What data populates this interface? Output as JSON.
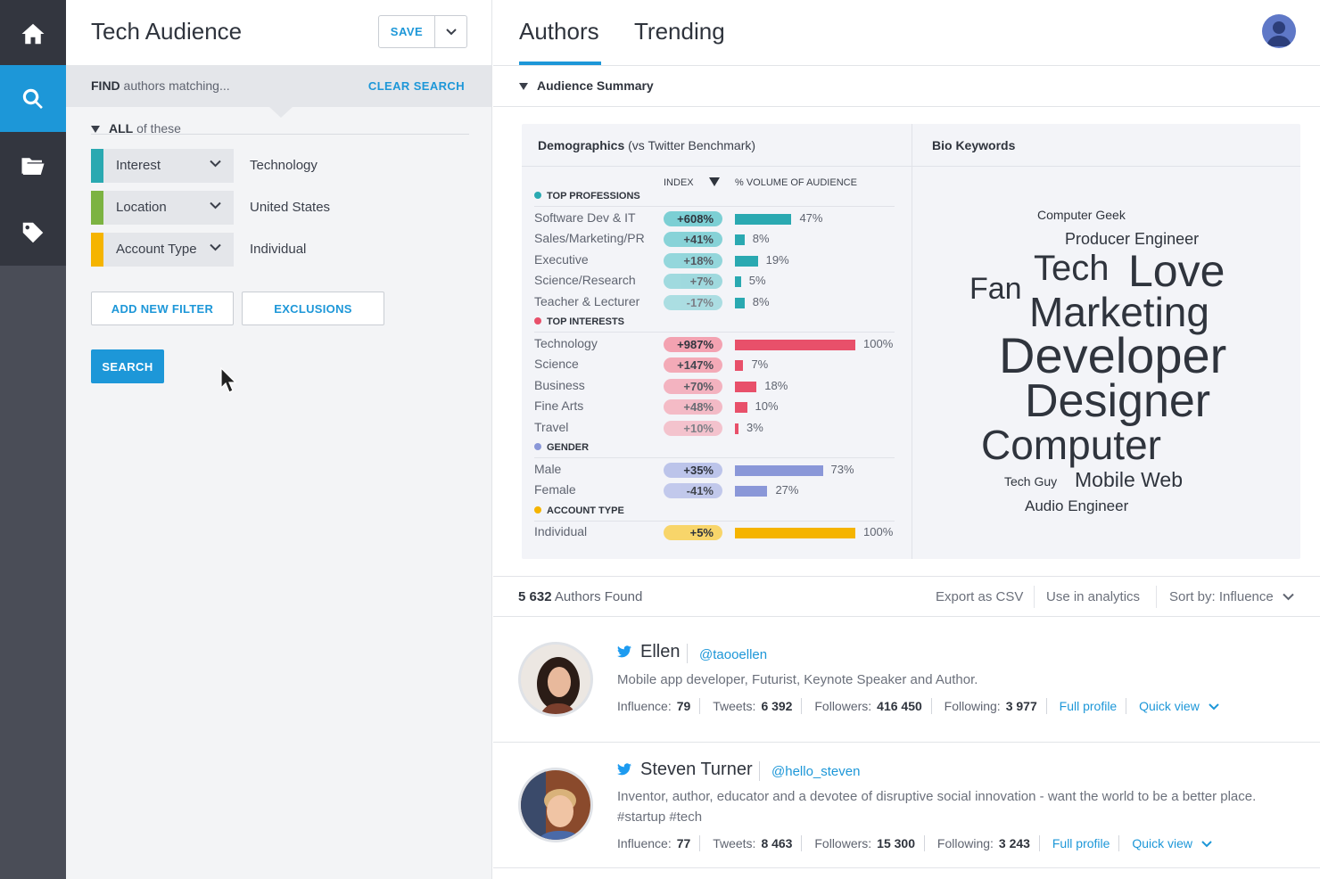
{
  "rail": {
    "items": [
      "home-icon",
      "search-icon",
      "folder-icon",
      "tag-icon"
    ],
    "active": "search-icon"
  },
  "panel": {
    "title": "Tech Audience",
    "save_label": "SAVE",
    "find_bold": "FIND",
    "find_rest": " authors matching...",
    "clear_search": "CLEAR SEARCH",
    "all_bold": "ALL",
    "all_rest": " of these",
    "filters": [
      {
        "label": "Interest",
        "value": "Technology",
        "color": "#2aa9b1"
      },
      {
        "label": "Location",
        "value": "United States",
        "color": "#7cb342"
      },
      {
        "label": "Account Type",
        "value": "Individual",
        "color": "#f5b400"
      }
    ],
    "add_filter": "ADD NEW FILTER",
    "exclusions": "EXCLUSIONS",
    "search": "SEARCH"
  },
  "tabs": [
    "Authors",
    "Trending"
  ],
  "active_tab": "Authors",
  "summary_label": "Audience Summary",
  "demographics": {
    "title_bold": "Demographics",
    "title_rest": " (vs Twitter Benchmark)",
    "col_index": "INDEX",
    "col_volume": "% VOLUME OF AUDIENCE",
    "sections": [
      {
        "name": "TOP PROFESSIONS",
        "color": "#2aa9b1",
        "light": "#7ccfd4",
        "rows": [
          {
            "label": "Software Dev & IT",
            "index": "+608%",
            "volume": 47
          },
          {
            "label": "Sales/Marketing/PR",
            "index": "+41%",
            "volume": 8
          },
          {
            "label": "Executive",
            "index": "+18%",
            "volume": 19
          },
          {
            "label": "Science/Research",
            "index": "+7%",
            "volume": 5
          },
          {
            "label": "Teacher & Lecturer",
            "index": "-17%",
            "volume": 8
          }
        ]
      },
      {
        "name": "TOP INTERESTS",
        "color": "#e8506a",
        "light": "#f3a2b1",
        "rows": [
          {
            "label": "Technology",
            "index": "+987%",
            "volume": 100
          },
          {
            "label": "Science",
            "index": "+147%",
            "volume": 7
          },
          {
            "label": "Business",
            "index": "+70%",
            "volume": 18
          },
          {
            "label": "Fine Arts",
            "index": "+48%",
            "volume": 10
          },
          {
            "label": "Travel",
            "index": "+10%",
            "volume": 3
          }
        ]
      },
      {
        "name": "GENDER",
        "color": "#8a97d8",
        "light": "#bcc4ea",
        "rows": [
          {
            "label": "Male",
            "index": "+35%",
            "volume": 73
          },
          {
            "label": "Female",
            "index": "-41%",
            "volume": 27
          }
        ]
      },
      {
        "name": "ACCOUNT TYPE",
        "color": "#f5b400",
        "light": "#f8d56a",
        "rows": [
          {
            "label": "Individual",
            "index": "+5%",
            "volume": 100
          }
        ]
      }
    ]
  },
  "bio_keywords": {
    "title": "Bio Keywords",
    "words": [
      "Computer Geek",
      "Producer Engineer",
      "Tech",
      "Love",
      "Fan",
      "Marketing",
      "Developer",
      "Designer",
      "Computer",
      "Tech Guy",
      "Mobile Web",
      "Audio Engineer"
    ]
  },
  "results": {
    "count": "5 632",
    "count_label": " Authors Found",
    "export": "Export as CSV",
    "analytics": "Use in analytics",
    "sort": "Sort by: Influence"
  },
  "authors": [
    {
      "name": "Ellen",
      "handle": "@taooellen",
      "bio": "Mobile app developer, Futurist, Keynote Speaker and Author.",
      "influence": "79",
      "tweets": "6 392",
      "followers": "416 450",
      "following": "3 977"
    },
    {
      "name": "Steven Turner",
      "handle": "@hello_steven",
      "bio": "Inventor, author, educator and a devotee of disruptive social innovation - want the world to be a better place. #startup #tech",
      "influence": "77",
      "tweets": "8 463",
      "followers": "15 300",
      "following": "3 243"
    }
  ],
  "stat_labels": {
    "influence": "Influence:",
    "tweets": "Tweets:",
    "followers": "Followers:",
    "following": "Following:",
    "full_profile": "Full profile",
    "quick_view": "Quick view"
  }
}
